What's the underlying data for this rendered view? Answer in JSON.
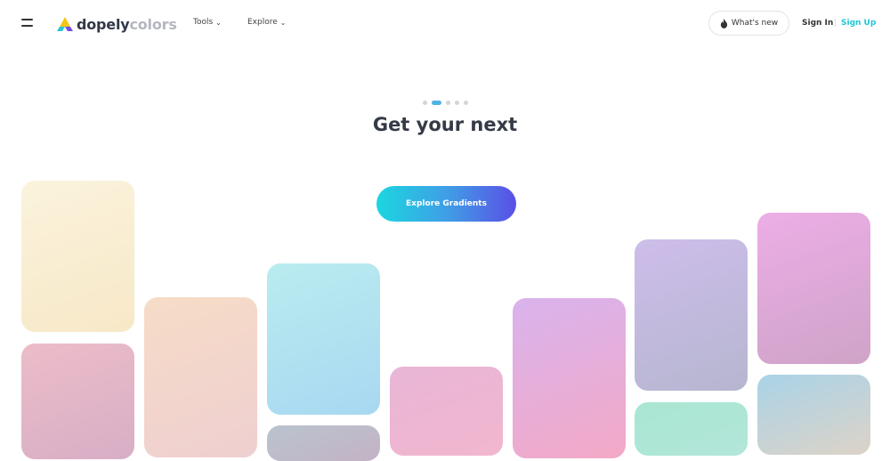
{
  "header": {
    "logo": {
      "main": "dopely",
      "sub": "colors"
    },
    "nav": [
      {
        "label": "Tools"
      },
      {
        "label": "Explore"
      }
    ],
    "whats_new_label": "What's new",
    "sign_in": "Sign In",
    "divider": "|",
    "sign_up": "Sign Up"
  },
  "hero": {
    "carousel": {
      "count": 5,
      "active_index": 1
    },
    "headline": "Get your next",
    "cta_label": "Explore Gradients"
  },
  "colors": {
    "accent": "#1ec6d6",
    "active_dot": "#4fb3e6",
    "cta_gradient": [
      "#1bd6e0",
      "#5a4fe6"
    ]
  },
  "icons": {
    "menu": "hamburger-icon",
    "logo": "dopely-logo-icon",
    "whats_new": "flame-icon",
    "nav_chevron": "chevron-down-icon"
  }
}
